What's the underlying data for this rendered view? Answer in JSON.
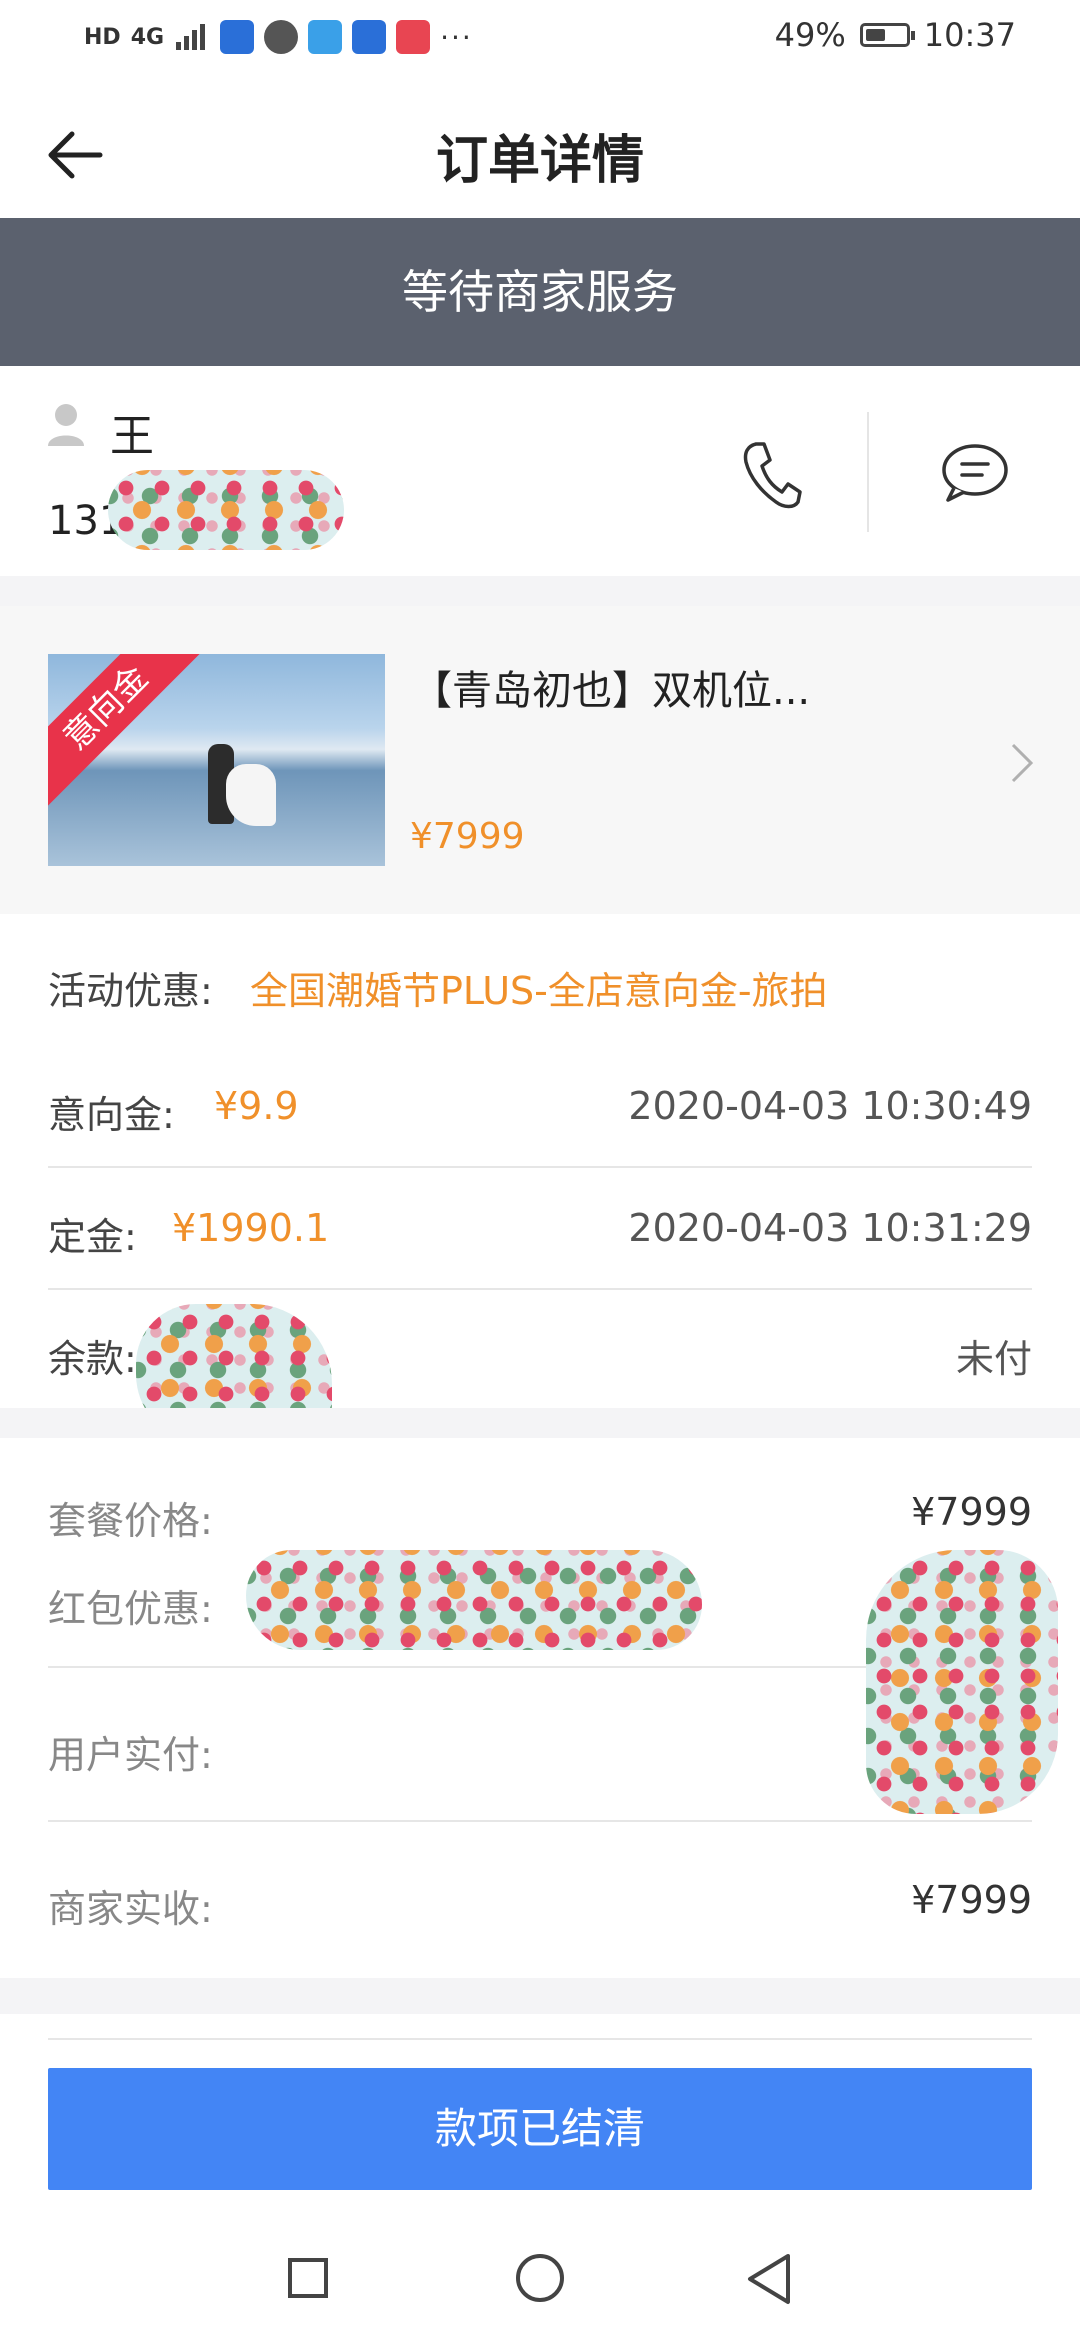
{
  "status_bar": {
    "hd": "HD",
    "network": "4G",
    "battery": "49%",
    "time": "10:37",
    "more": "···",
    "battery_level": 0.49
  },
  "nav": {
    "title": "订单详情"
  },
  "banner": {
    "status": "等待商家服务"
  },
  "contact": {
    "name": "王",
    "phone_prefix": "131"
  },
  "product": {
    "badge": "意向金",
    "title": "【青岛初也】双机位...",
    "price": "¥7999"
  },
  "promo": {
    "label": "活动优惠:",
    "value": "全国潮婚节PLUS-全店意向金-旅拍"
  },
  "payments": [
    {
      "label": "意向金:",
      "amount": "¥9.9",
      "time": "2020-04-03 10:30:49"
    },
    {
      "label": "定金:",
      "amount": "¥1990.1",
      "time": "2020-04-03 10:31:29"
    },
    {
      "label": "余款:",
      "amount": "",
      "time": "未付"
    }
  ],
  "summary": {
    "package_label": "套餐价格:",
    "package_value": "¥7999",
    "redpacket_label": "红包优惠:",
    "user_paid_label": "用户实付:",
    "merchant_label": "商家实收:",
    "merchant_value": "¥7999"
  },
  "action": {
    "settled": "款项已结清"
  },
  "colors": {
    "banner": "#5b616e",
    "accent": "#f0902a",
    "button": "#4385f5",
    "ribbon": "#e8334a"
  }
}
